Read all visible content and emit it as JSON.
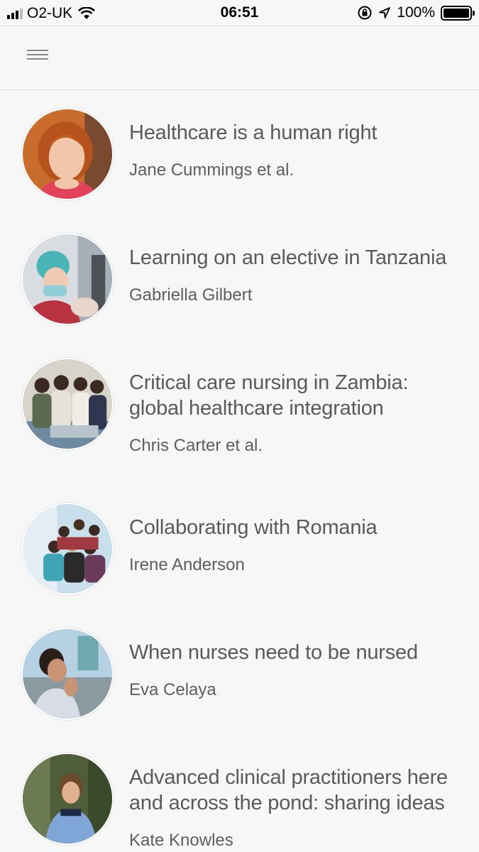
{
  "status_bar": {
    "carrier": "O2-UK",
    "time": "06:51",
    "battery": "100%",
    "icons": [
      "signal-icon",
      "wifi-icon",
      "rotation-lock-icon",
      "location-arrow-icon",
      "battery-icon"
    ]
  },
  "header": {
    "menu_icon": "hamburger-menu-icon"
  },
  "articles": [
    {
      "title": "Healthcare is a human right",
      "author": "Jane Cummings et al.",
      "thumbnail": "portrait-photo"
    },
    {
      "title": "Learning on an elective in Tanzania",
      "author": "Gabriella Gilbert",
      "thumbnail": "hospital-photo"
    },
    {
      "title": "Critical care nursing in Zambia: global healthcare integration",
      "author": "Chris Carter et al.",
      "thumbnail": "group-photo"
    },
    {
      "title": "Collaborating with Romania",
      "author": "Irene Anderson",
      "thumbnail": "group-photo"
    },
    {
      "title": "When nurses need to be nursed",
      "author": "Eva Celaya",
      "thumbnail": "portrait-photo"
    },
    {
      "title": "Advanced clinical practitioners here and across the pond: sharing ideas",
      "author": "Kate Knowles",
      "thumbnail": "outdoor-portrait-photo"
    }
  ]
}
